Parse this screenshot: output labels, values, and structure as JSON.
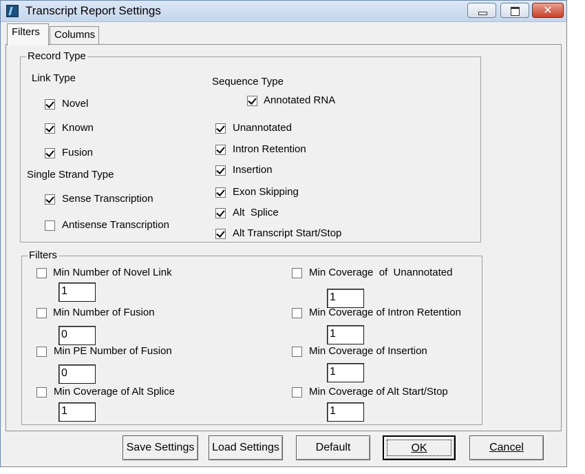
{
  "window": {
    "title": "Transcript Report Settings"
  },
  "tabs": [
    {
      "label": "Filters"
    },
    {
      "label": "Columns"
    }
  ],
  "record_type": {
    "legend": "Record Type",
    "link_type": {
      "label": "Link Type",
      "items": [
        {
          "label": "Novel",
          "checked": true
        },
        {
          "label": "Known",
          "checked": true
        },
        {
          "label": "Fusion",
          "checked": true
        }
      ]
    },
    "single_strand_type": {
      "label": "Single Strand Type",
      "items": [
        {
          "label": "Sense Transcription",
          "checked": true
        },
        {
          "label": "Antisense Transcription",
          "checked": false
        }
      ]
    },
    "sequence_type": {
      "label": "Sequence Type",
      "annotated": {
        "label": "Annotated RNA",
        "checked": true
      },
      "items": [
        {
          "label": "Unannotated",
          "checked": true
        },
        {
          "label": "Intron Retention",
          "checked": true
        },
        {
          "label": "Insertion",
          "checked": true
        },
        {
          "label": "Exon Skipping",
          "checked": true
        },
        {
          "label": "Alt  Splice",
          "checked": true
        },
        {
          "label": "Alt Transcript Start/Stop",
          "checked": true
        }
      ]
    }
  },
  "filters": {
    "legend": "Filters",
    "left": [
      {
        "label": "Min Number of Novel Link",
        "value": "1",
        "checked": false
      },
      {
        "label": "Min Number of Fusion",
        "value": "0",
        "checked": false
      },
      {
        "label": "Min PE Number of Fusion",
        "value": "0",
        "checked": false
      },
      {
        "label": "Min Coverage of Alt Splice",
        "value": "1",
        "checked": false
      }
    ],
    "right": [
      {
        "label": "Min Coverage  of  Unannotated",
        "value": "1",
        "checked": false
      },
      {
        "label": "Min Coverage of Intron Retention",
        "value": "1",
        "checked": false
      },
      {
        "label": "Min Coverage of Insertion",
        "value": "1",
        "checked": false
      },
      {
        "label": "Min Coverage of Alt Start/Stop",
        "value": "1",
        "checked": false
      }
    ]
  },
  "buttons": {
    "save": "Save Settings",
    "load": "Load Settings",
    "default": "Default",
    "ok": "OK",
    "cancel": "Cancel"
  }
}
